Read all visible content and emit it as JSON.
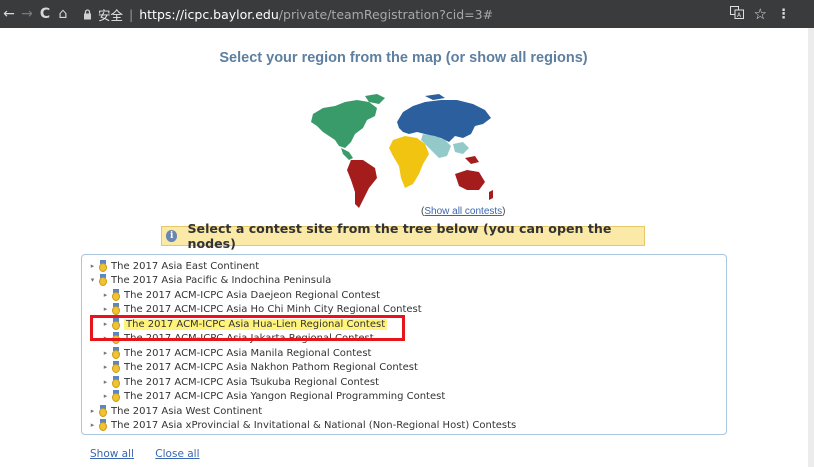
{
  "browser": {
    "back_icon": "←",
    "forward_icon": "→",
    "reload_icon": "C",
    "home_icon": "⌂",
    "lock_icon": "🔒",
    "secure_label": "安全",
    "separator": "|",
    "url_host": "https://icpc.baylor.edu",
    "url_path": "/private/teamRegistration?cid=3#",
    "translate_icon": "▤",
    "star_icon": "☆",
    "menu_icon": "⋮"
  },
  "page": {
    "region_title": "Select your region from the map (or show all regions)",
    "show_all_contests_open": "(",
    "show_all_contests_link": "Show all contests",
    "show_all_contests_close": ")",
    "notice_icon": "i",
    "notice_text": "Select a contest site from the tree below (you can open the nodes)",
    "map_colors": {
      "north_america": "#3a9b6a",
      "south_america": "#a51c1c",
      "europe_asia": "#2c5f9e",
      "africa": "#f2c412",
      "middle_east": "#93c9c9",
      "oceania": "#a51c1c"
    }
  },
  "tree": {
    "nodes": [
      {
        "label": "The 2017 Asia East Continent",
        "expanded": false,
        "level": 0
      },
      {
        "label": "The 2017 Asia Pacific & Indochina Peninsula",
        "expanded": true,
        "level": 0
      },
      {
        "label": "The 2017 ACM-ICPC Asia Daejeon Regional Contest",
        "expanded": false,
        "level": 1
      },
      {
        "label": "The 2017 ACM-ICPC Asia Ho Chi Minh City Regional Contest",
        "expanded": false,
        "level": 1
      },
      {
        "label": "The 2017 ACM-ICPC Asia Hua-Lien Regional Contest",
        "expanded": false,
        "level": 1,
        "selected": true
      },
      {
        "label": "The 2017 ACM-ICPC Asia Jakarta Regional Contest",
        "expanded": false,
        "level": 1
      },
      {
        "label": "The 2017 ACM-ICPC Asia Manila Regional Contest",
        "expanded": false,
        "level": 1
      },
      {
        "label": "The 2017 ACM-ICPC Asia Nakhon Pathom Regional Contest",
        "expanded": false,
        "level": 1
      },
      {
        "label": "The 2017 ACM-ICPC Asia Tsukuba Regional Contest",
        "expanded": false,
        "level": 1
      },
      {
        "label": "The 2017 ACM-ICPC Asia Yangon Regional Programming Contest",
        "expanded": false,
        "level": 1
      },
      {
        "label": "The 2017 Asia West Continent",
        "expanded": false,
        "level": 0
      },
      {
        "label": "The 2017 Asia xProvincial & Invitational & National (Non-Regional Host) Contests",
        "expanded": false,
        "level": 0
      }
    ],
    "collapsed_toggle": "▸",
    "expanded_toggle": "▾"
  },
  "footer": {
    "show_all": "Show all",
    "close_all": "Close all"
  }
}
